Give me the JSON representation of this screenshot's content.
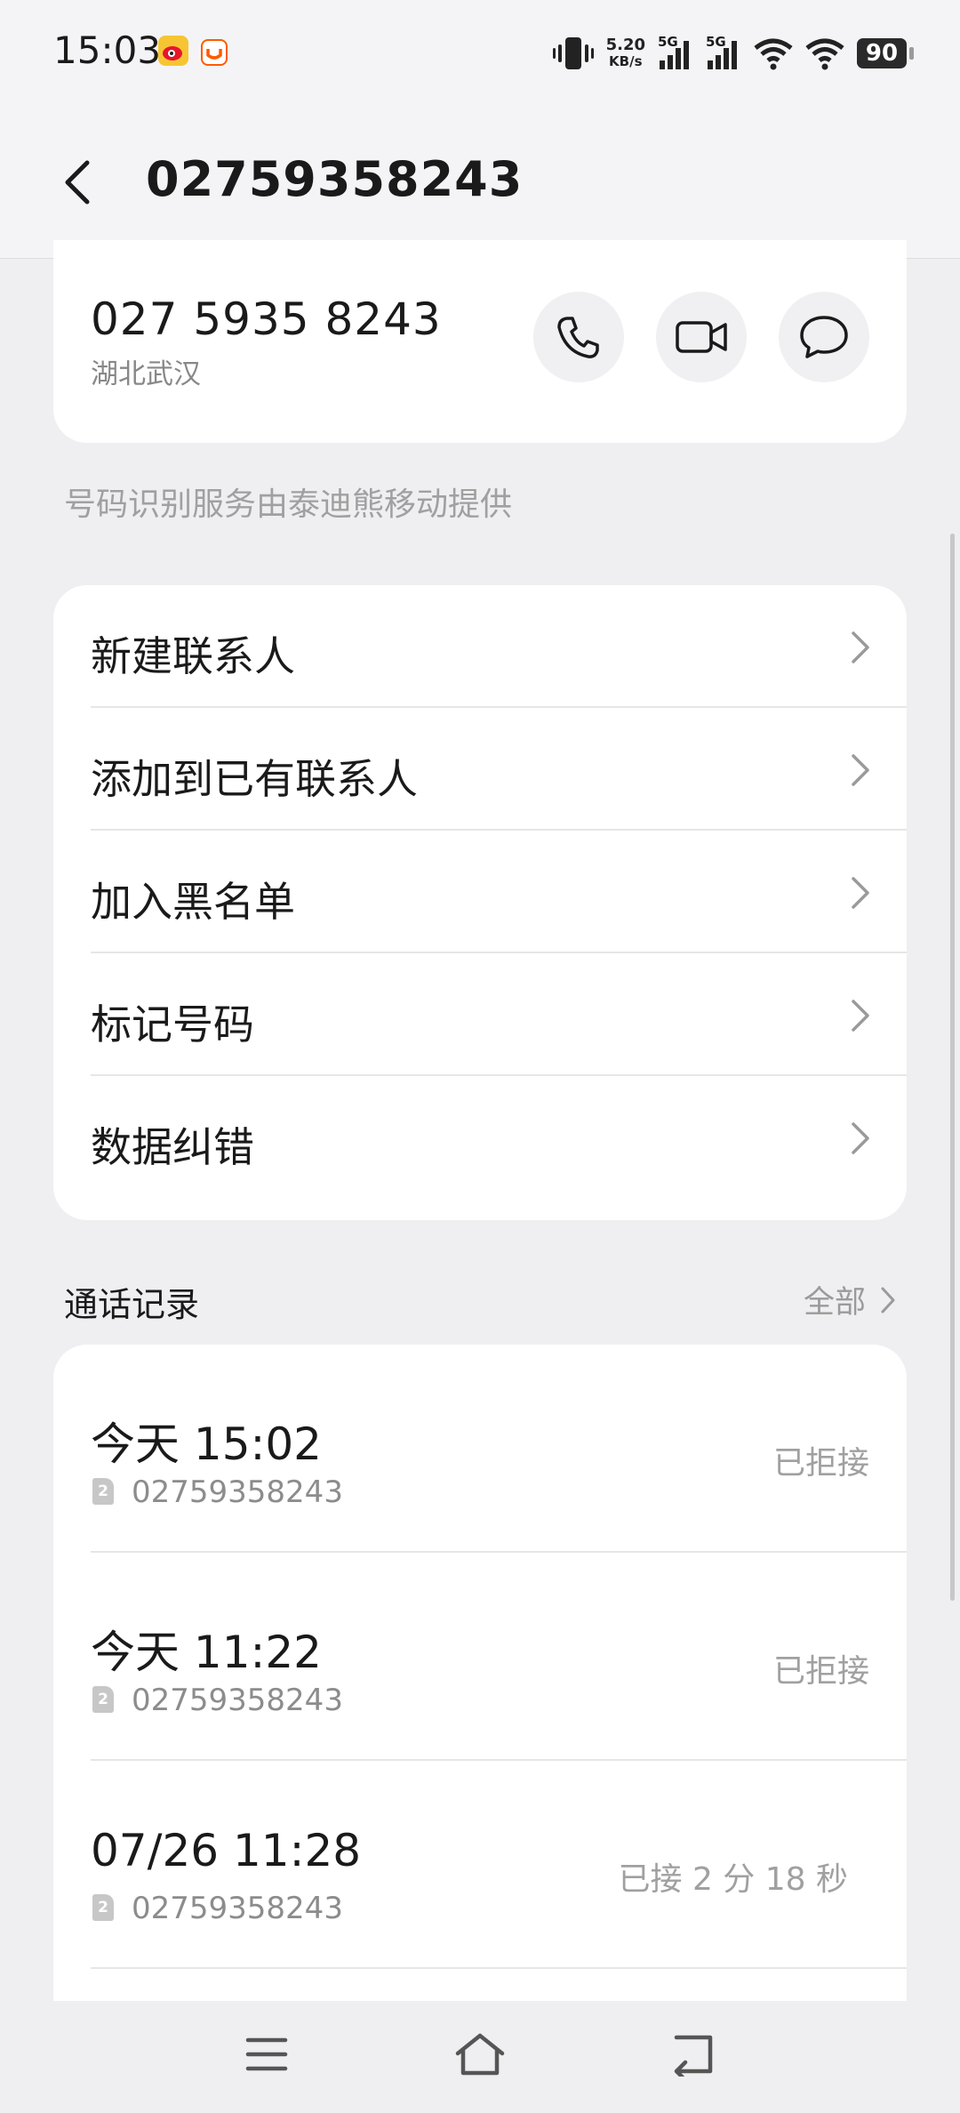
{
  "status_bar": {
    "time": "15:03",
    "net_speed_value": "5.20",
    "net_speed_unit": "KB/s",
    "signal1_label": "5G",
    "signal2_label": "5G",
    "battery": "90"
  },
  "header": {
    "title": "02759358243"
  },
  "number_card": {
    "formatted_number": "027 5935 8243",
    "location": "湖北武汉"
  },
  "provider_note": "号码识别服务由泰迪熊移动提供",
  "actions": [
    {
      "label": "新建联系人"
    },
    {
      "label": "添加到已有联系人"
    },
    {
      "label": "加入黑名单"
    },
    {
      "label": "标记号码"
    },
    {
      "label": "数据纠错"
    }
  ],
  "call_log": {
    "title": "通话记录",
    "all_label": "全部",
    "sim_label": "2",
    "entries": [
      {
        "time": "今天 15:02",
        "number": "02759358243",
        "status": "已拒接"
      },
      {
        "time": "今天 11:22",
        "number": "02759358243",
        "status": "已拒接"
      },
      {
        "time": "07/26 11:28",
        "number": "02759358243",
        "status": "已接 2 分 18 秒"
      }
    ]
  }
}
